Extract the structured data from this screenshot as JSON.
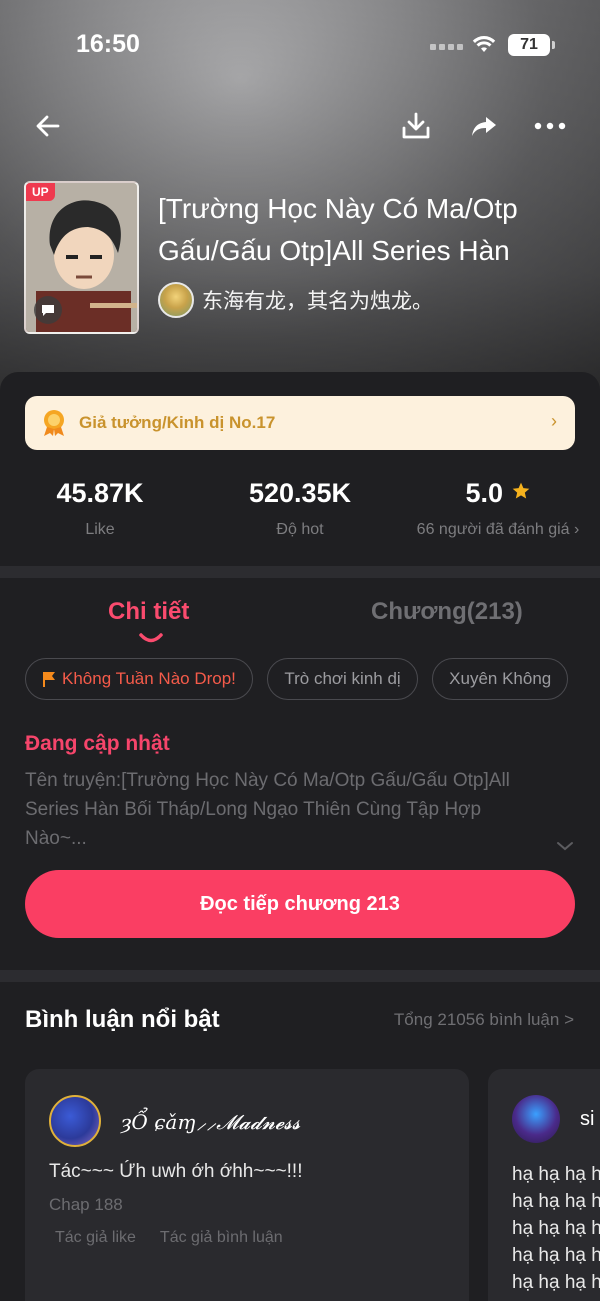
{
  "status_bar": {
    "time": "16:50",
    "battery": "71"
  },
  "book": {
    "up_badge": "UP",
    "title": "[Trường Học Này Có Ma/Otp Gấu/Gấu Otp]All Series Hàn",
    "author": "东海有龙，其名为烛龙。"
  },
  "rank": {
    "text": "Giả tưởng/Kinh dị No.17",
    "chevron": "›"
  },
  "stats": [
    {
      "value": "45.87K",
      "label": "Like"
    },
    {
      "value": "520.35K",
      "label": "Độ hot"
    },
    {
      "value": "5.0",
      "label": "66 người đã đánh giá ›"
    }
  ],
  "tabs": {
    "detail": "Chi tiết",
    "chapters": "Chương(213)"
  },
  "tags": [
    "Không Tuần Nào Drop!",
    "Trò chơi kinh dị",
    "Xuyên Không"
  ],
  "status_label": "Đang cập nhật",
  "description": "Tên truyện:[Trường Học Này Có Ma/Otp Gấu/Gấu Otp]All Series Hàn Bối Tháp/Long Ngạo Thiên Cùng Tập Hợp Nào~...",
  "read_button": "Đọc tiếp chương 213",
  "comments": {
    "title": "Bình luận nổi bật",
    "total": "Tổng 21056 bình luận >",
    "cards": [
      {
        "user": "ȝỔ ɕǎɱ⸝⸝𝓜𝓪𝓭𝓷𝓮𝓼𝓼",
        "text": "Tác~~~ Ứh uwh ớh ớhh~~~!!!",
        "chapter": "Chap 188",
        "badge_like": "Tác giả like",
        "badge_comment": "Tác giả bình luận"
      },
      {
        "user": "si",
        "lines": [
          "hạ hạ hạ h",
          "hạ hạ hạ h",
          "hạ hạ hạ h",
          "hạ hạ hạ h",
          "hạ hạ hạ h"
        ]
      }
    ]
  },
  "colors": {
    "accent": "#fa3e63",
    "rank_bg": "#fdf1dd",
    "rank_text": "#c9932d",
    "star": "#f5b21e"
  }
}
